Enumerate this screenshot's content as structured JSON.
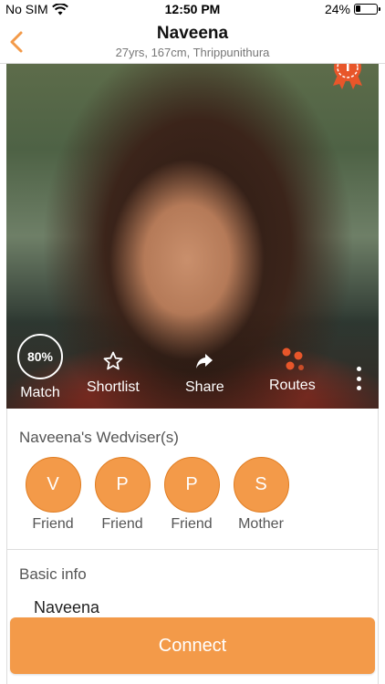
{
  "status_bar": {
    "carrier": "No SIM",
    "time": "12:50 PM",
    "battery_percent_text": "24%",
    "battery_level": 0.24
  },
  "header": {
    "title": "Naveena",
    "subtitle": "27yrs, 167cm, Thrippunithura",
    "back_icon": "chevron-left-icon"
  },
  "profile": {
    "match_percent": "80%",
    "actions": {
      "match_label": "Match",
      "shortlist_label": "Shortlist",
      "share_label": "Share",
      "routes_label": "Routes"
    }
  },
  "wedvisers": {
    "title": "Naveena's Wedviser(s)",
    "items": [
      {
        "initial": "V",
        "relation": "Friend"
      },
      {
        "initial": "P",
        "relation": "Friend"
      },
      {
        "initial": "P",
        "relation": "Friend"
      },
      {
        "initial": "S",
        "relation": "Mother"
      }
    ]
  },
  "basic_info": {
    "title": "Basic info",
    "name": "Naveena"
  },
  "connect_button": "Connect",
  "colors": {
    "accent": "#f39a49",
    "accent_dark": "#e07d22",
    "rosette": "#e8562a"
  }
}
